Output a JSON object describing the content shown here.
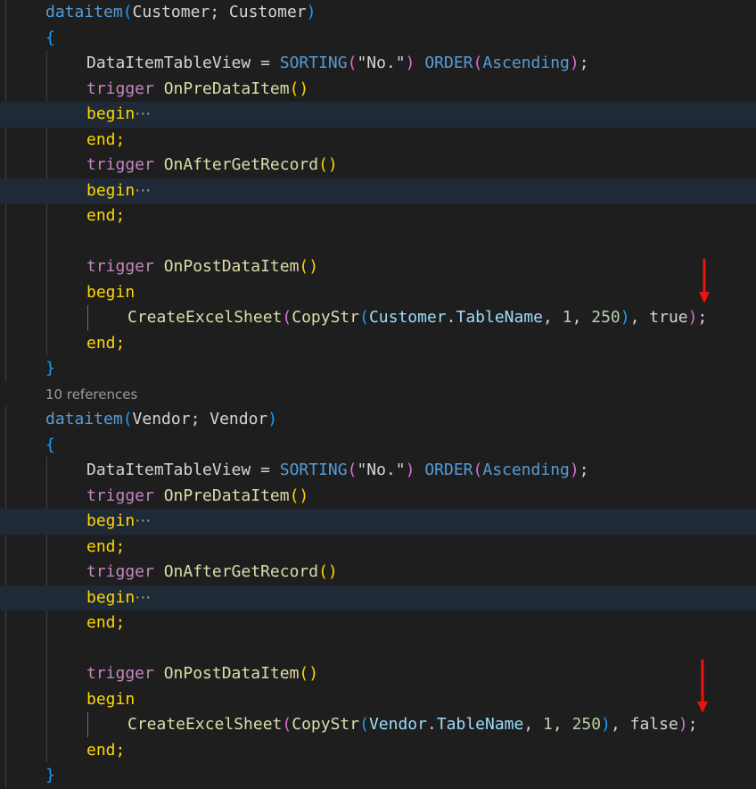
{
  "colors": {
    "keyword": "#c586c0",
    "dataitem": "#569cd6",
    "function": "#dcdcaa",
    "text": "#d4d4d4",
    "string": "#ce9178",
    "number": "#b5cea8",
    "property": "#9cdcfe",
    "type": "#4ec9b0",
    "bracket_gold": "#ffd700",
    "bracket_purple": "#da70d6",
    "bracket_blue": "#179fff",
    "annotation_arrow": "#e8140e"
  },
  "editor": {
    "font_size_px": 18,
    "lines": [
      {
        "indent": 1,
        "tokens": [
          {
            "t": "dataitem",
            "c": "dataitem"
          },
          {
            "t": "(",
            "c": "bracket_blue"
          },
          {
            "t": "Customer; Customer",
            "c": "text"
          },
          {
            "t": ")",
            "c": "bracket_blue"
          }
        ]
      },
      {
        "indent": 1,
        "tokens": [
          {
            "t": "{",
            "c": "bracket_blue"
          }
        ]
      },
      {
        "indent": 2,
        "tokens": [
          {
            "t": "DataItemTableView = ",
            "c": "text"
          },
          {
            "t": "SORTING",
            "c": "dataitem"
          },
          {
            "t": "(",
            "c": "bracket_purple"
          },
          {
            "t": "\"No.\"",
            "c": "text"
          },
          {
            "t": ")",
            "c": "bracket_purple"
          },
          {
            "t": " ",
            "c": "text"
          },
          {
            "t": "ORDER",
            "c": "dataitem"
          },
          {
            "t": "(",
            "c": "bracket_purple"
          },
          {
            "t": "Ascending",
            "c": "dataitem"
          },
          {
            "t": ")",
            "c": "bracket_purple"
          },
          {
            "t": ";",
            "c": "text"
          }
        ]
      },
      {
        "indent": 2,
        "tokens": [
          {
            "t": "trigger",
            "c": "keyword"
          },
          {
            "t": " ",
            "c": "text"
          },
          {
            "t": "OnPreDataItem",
            "c": "function"
          },
          {
            "t": "()",
            "c": "bracket_gold"
          }
        ]
      },
      {
        "indent": 2,
        "highlight": true,
        "folded": true,
        "tokens": [
          {
            "t": "begin",
            "c": "bracket_gold"
          }
        ]
      },
      {
        "indent": 2,
        "tokens": [
          {
            "t": "end;",
            "c": "bracket_gold"
          }
        ]
      },
      {
        "indent": 2,
        "tokens": [
          {
            "t": "trigger",
            "c": "keyword"
          },
          {
            "t": " ",
            "c": "text"
          },
          {
            "t": "OnAfterGetRecord",
            "c": "function"
          },
          {
            "t": "()",
            "c": "bracket_gold"
          }
        ]
      },
      {
        "indent": 2,
        "highlight": true,
        "folded": true,
        "tokens": [
          {
            "t": "begin",
            "c": "bracket_gold"
          }
        ]
      },
      {
        "indent": 2,
        "tokens": [
          {
            "t": "end;",
            "c": "bracket_gold"
          }
        ]
      },
      {
        "indent": 2,
        "tokens": []
      },
      {
        "indent": 2,
        "tokens": [
          {
            "t": "trigger",
            "c": "keyword"
          },
          {
            "t": " ",
            "c": "text"
          },
          {
            "t": "OnPostDataItem",
            "c": "function"
          },
          {
            "t": "()",
            "c": "bracket_gold"
          }
        ]
      },
      {
        "indent": 2,
        "tokens": [
          {
            "t": "begin",
            "c": "bracket_gold"
          }
        ]
      },
      {
        "indent": 3,
        "tokens": [
          {
            "t": "CreateExcelSheet",
            "c": "function"
          },
          {
            "t": "(",
            "c": "bracket_purple"
          },
          {
            "t": "CopyStr",
            "c": "function"
          },
          {
            "t": "(",
            "c": "bracket_blue"
          },
          {
            "t": "Customer",
            "c": "property"
          },
          {
            "t": ".",
            "c": "text"
          },
          {
            "t": "TableName",
            "c": "property"
          },
          {
            "t": ", ",
            "c": "text"
          },
          {
            "t": "1",
            "c": "number"
          },
          {
            "t": ", ",
            "c": "text"
          },
          {
            "t": "250",
            "c": "number"
          },
          {
            "t": ")",
            "c": "bracket_blue"
          },
          {
            "t": ", ",
            "c": "text"
          },
          {
            "t": "true",
            "c": "text"
          },
          {
            "t": ")",
            "c": "bracket_purple"
          },
          {
            "t": ";",
            "c": "text"
          }
        ]
      },
      {
        "indent": 2,
        "tokens": [
          {
            "t": "end;",
            "c": "bracket_gold"
          }
        ]
      },
      {
        "indent": 1,
        "tokens": [
          {
            "t": "}",
            "c": "bracket_blue"
          }
        ]
      },
      {
        "indent": 1,
        "codelens": "10 references"
      },
      {
        "indent": 1,
        "tokens": [
          {
            "t": "dataitem",
            "c": "dataitem"
          },
          {
            "t": "(",
            "c": "bracket_blue"
          },
          {
            "t": "Vendor; Vendor",
            "c": "text"
          },
          {
            "t": ")",
            "c": "bracket_blue"
          }
        ]
      },
      {
        "indent": 1,
        "tokens": [
          {
            "t": "{",
            "c": "bracket_blue"
          }
        ]
      },
      {
        "indent": 2,
        "tokens": [
          {
            "t": "DataItemTableView = ",
            "c": "text"
          },
          {
            "t": "SORTING",
            "c": "dataitem"
          },
          {
            "t": "(",
            "c": "bracket_purple"
          },
          {
            "t": "\"No.\"",
            "c": "text"
          },
          {
            "t": ")",
            "c": "bracket_purple"
          },
          {
            "t": " ",
            "c": "text"
          },
          {
            "t": "ORDER",
            "c": "dataitem"
          },
          {
            "t": "(",
            "c": "bracket_purple"
          },
          {
            "t": "Ascending",
            "c": "dataitem"
          },
          {
            "t": ")",
            "c": "bracket_purple"
          },
          {
            "t": ";",
            "c": "text"
          }
        ]
      },
      {
        "indent": 2,
        "tokens": [
          {
            "t": "trigger",
            "c": "keyword"
          },
          {
            "t": " ",
            "c": "text"
          },
          {
            "t": "OnPreDataItem",
            "c": "function"
          },
          {
            "t": "()",
            "c": "bracket_gold"
          }
        ]
      },
      {
        "indent": 2,
        "highlight": true,
        "folded": true,
        "tokens": [
          {
            "t": "begin",
            "c": "bracket_gold"
          }
        ]
      },
      {
        "indent": 2,
        "tokens": [
          {
            "t": "end;",
            "c": "bracket_gold"
          }
        ]
      },
      {
        "indent": 2,
        "tokens": [
          {
            "t": "trigger",
            "c": "keyword"
          },
          {
            "t": " ",
            "c": "text"
          },
          {
            "t": "OnAfterGetRecord",
            "c": "function"
          },
          {
            "t": "()",
            "c": "bracket_gold"
          }
        ]
      },
      {
        "indent": 2,
        "highlight": true,
        "folded": true,
        "tokens": [
          {
            "t": "begin",
            "c": "bracket_gold"
          }
        ]
      },
      {
        "indent": 2,
        "tokens": [
          {
            "t": "end;",
            "c": "bracket_gold"
          }
        ]
      },
      {
        "indent": 2,
        "tokens": []
      },
      {
        "indent": 2,
        "tokens": [
          {
            "t": "trigger",
            "c": "keyword"
          },
          {
            "t": " ",
            "c": "text"
          },
          {
            "t": "OnPostDataItem",
            "c": "function"
          },
          {
            "t": "()",
            "c": "bracket_gold"
          }
        ]
      },
      {
        "indent": 2,
        "tokens": [
          {
            "t": "begin",
            "c": "bracket_gold"
          }
        ]
      },
      {
        "indent": 3,
        "tokens": [
          {
            "t": "CreateExcelSheet",
            "c": "function"
          },
          {
            "t": "(",
            "c": "bracket_purple"
          },
          {
            "t": "CopyStr",
            "c": "function"
          },
          {
            "t": "(",
            "c": "bracket_blue"
          },
          {
            "t": "Vendor",
            "c": "property"
          },
          {
            "t": ".",
            "c": "text"
          },
          {
            "t": "TableName",
            "c": "property"
          },
          {
            "t": ", ",
            "c": "text"
          },
          {
            "t": "1",
            "c": "number"
          },
          {
            "t": ", ",
            "c": "text"
          },
          {
            "t": "250",
            "c": "number"
          },
          {
            "t": ")",
            "c": "bracket_blue"
          },
          {
            "t": ", ",
            "c": "text"
          },
          {
            "t": "false",
            "c": "text"
          },
          {
            "t": ")",
            "c": "bracket_purple"
          },
          {
            "t": ";",
            "c": "text"
          }
        ]
      },
      {
        "indent": 2,
        "tokens": [
          {
            "t": "end;",
            "c": "bracket_gold"
          }
        ]
      },
      {
        "indent": 1,
        "tokens": [
          {
            "t": "}",
            "c": "bracket_blue"
          }
        ]
      }
    ]
  },
  "annotations": [
    {
      "icon": "red-arrow-down-icon",
      "points_to": "true"
    },
    {
      "icon": "red-arrow-down-icon",
      "points_to": "false"
    }
  ]
}
